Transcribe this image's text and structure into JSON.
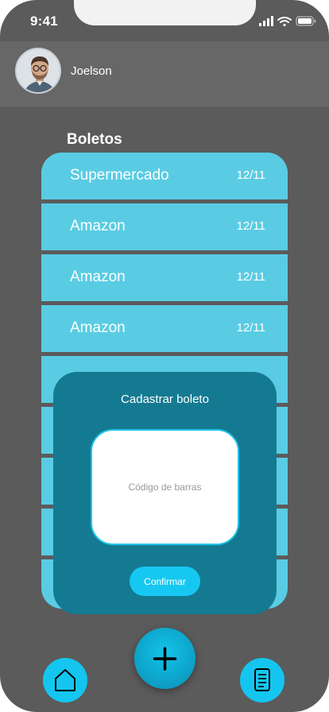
{
  "status_bar": {
    "time": "9:41",
    "icons": [
      "signal-icon",
      "wifi-icon",
      "battery-icon"
    ]
  },
  "header": {
    "user_name": "Joelson"
  },
  "section": {
    "title": "Boletos"
  },
  "boletos": [
    {
      "name": "Supermercado",
      "date": "12/11"
    },
    {
      "name": "Amazon",
      "date": "12/11"
    },
    {
      "name": "Amazon",
      "date": "12/11"
    },
    {
      "name": "Amazon",
      "date": "12/11"
    }
  ],
  "modal": {
    "title": "Cadastrar boleto",
    "barcode_placeholder": "Código de barras",
    "barcode_value": "",
    "confirm_label": "Confirmar"
  },
  "bottom_nav": {
    "home_icon": "home-icon",
    "add_icon": "plus-icon",
    "document_icon": "document-icon"
  },
  "colors": {
    "background": "#5b5b5b",
    "list_item": "#59cce3",
    "modal": "#147a92",
    "accent": "#16c8f1"
  }
}
